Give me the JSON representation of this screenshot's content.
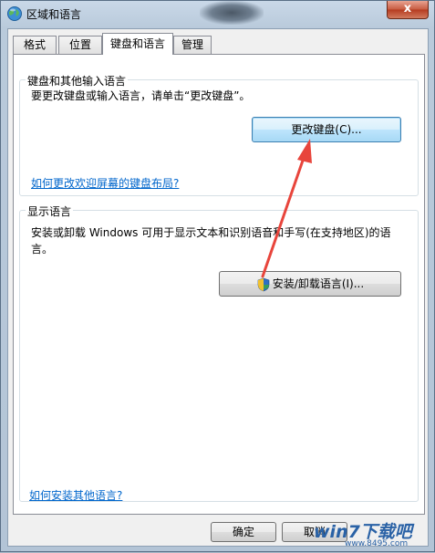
{
  "window": {
    "title": "区域和语言",
    "close_label": "x"
  },
  "tabs": [
    {
      "label": "格式"
    },
    {
      "label": "位置"
    },
    {
      "label": "键盘和语言"
    },
    {
      "label": "管理"
    }
  ],
  "keyboard_group": {
    "title": "键盘和其他输入语言",
    "description": "要更改键盘或输入语言，请单击“更改键盘”。",
    "change_button": "更改键盘(C)...",
    "link": "如何更改欢迎屏幕的键盘布局?"
  },
  "display_group": {
    "title": "显示语言",
    "description": "安装或卸载 Windows 可用于显示文本和识别语音和手写(在支持地区)的语言。",
    "install_button": "安装/卸载语言(I)...",
    "install_icon": "uac-shield-icon"
  },
  "footer": {
    "link": "如何安装其他语言?",
    "ok_button": "确定",
    "cancel_button": "取消"
  },
  "watermark": {
    "brand": "win7下载吧",
    "url": "www.8495.com"
  },
  "colors": {
    "arrow": "#e8453c",
    "link": "#0066cc",
    "focused_button": "#3c7fb1"
  }
}
